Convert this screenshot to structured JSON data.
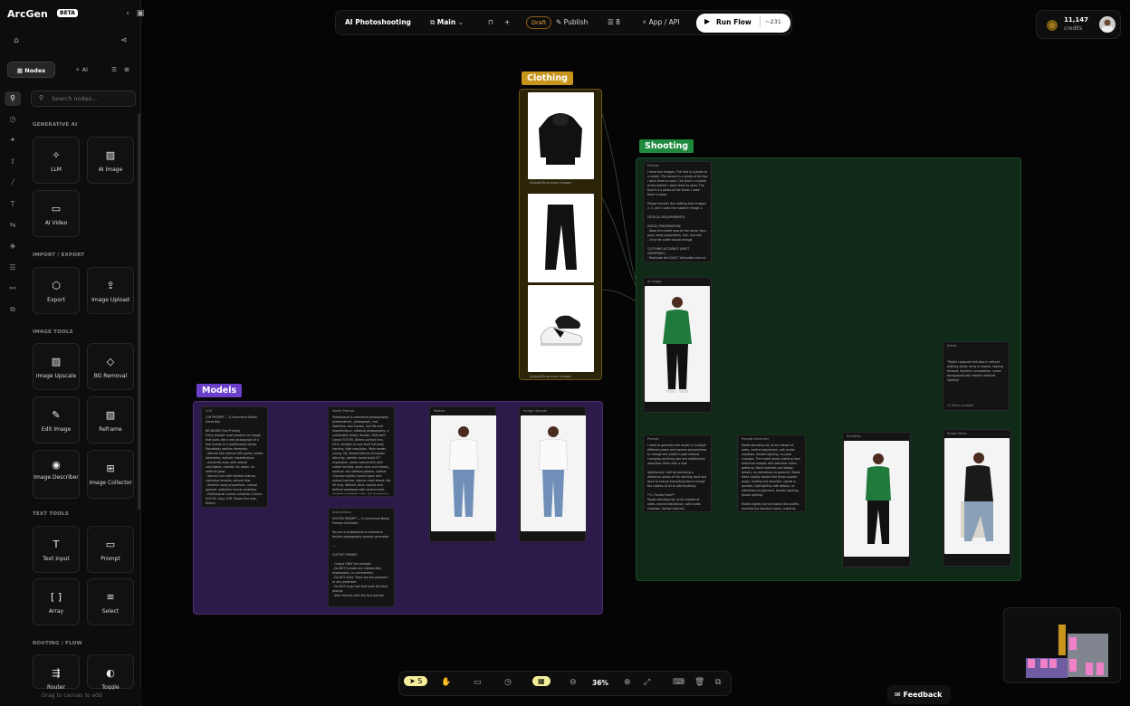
{
  "brand": {
    "name": "ArcGen",
    "badge": "BETA"
  },
  "sidebar": {
    "tabs": [
      {
        "label": "Nodes"
      },
      {
        "label": "AI"
      }
    ],
    "search_placeholder": "Search nodes...",
    "sections": [
      {
        "title": "GENERATIVE AI",
        "items": [
          "LLM",
          "AI Image",
          "AI Video"
        ]
      },
      {
        "title": "IMPORT / EXPORT",
        "items": [
          "Export",
          "Image Upload"
        ]
      },
      {
        "title": "IMAGE TOOLS",
        "items": [
          "Image Upscale",
          "BG Removal",
          "Edit Image",
          "Reframe",
          "Image Describer",
          "Image Collector"
        ]
      },
      {
        "title": "TEXT TOOLS",
        "items": [
          "Text Input",
          "Prompt",
          "Array",
          "Select"
        ]
      },
      {
        "title": "ROUTING / FLOW",
        "items": [
          "Router",
          "Toggle"
        ]
      }
    ],
    "drag_hint": "Drag to canvas to add"
  },
  "topbar": {
    "project": "AI Photoshooting",
    "branch": "Main",
    "status": "Draft",
    "publish": "Publish",
    "count": "8",
    "app_api": "App / API",
    "run_label": "Run Flow",
    "run_cost": "~231"
  },
  "account": {
    "credits_value": "11,147",
    "credits_label": "credits"
  },
  "groups": {
    "clothing": "Clothing",
    "shooting": "Shooting",
    "models": "Models"
  },
  "nodes": {
    "upload_label": "Upload/Drop more images",
    "prompt_label": "Prompt",
    "ai_image_label": "AI Image",
    "model_prompt": "Model Prompt",
    "models_label": "Models",
    "image_upscale": "Image Upscale",
    "instructions": "Instructions",
    "select_label": "Select",
    "prompt_enhancer": "Prompt enhancer",
    "shooting_node": "Shooting",
    "single_shots": "Single Shots",
    "shooting_prompt_text": "I have four images. The first is a photo of a model. The second is a photo of the top I want them to wear. The third is a photo of the bottom I want them to wear. The fourth is a photo of the shoes I want them to wear.\n\nPlease transfer the clothing from images 2, 3, and 4 onto the model in image 1.\n\nCRITICAL REQUIREMENTS:\n\nMODEL PRESERVATION:\n- Keep the model exactly the same: face, pose, body proportions, hair, and skin\n- Only the outfit should change\n\nCLOTHING ACCURACY (MOST IMPORTANT):\n- Replicate the EXACT silhouette and cut of each garment. Use the reference images",
    "models_text": "LLM PROMPT — E-Commerce Model Generator\n\nBEHAVIOR (Say Priority)\nEvery prompt must produce an image that looks like a real photograph of a real human in a professional studio.\nMandatory realism elements:\n- Natural skin texture with pores, subtle blemishes, realistic imperfections\n- Authentic eyes with natural catchlights, realistic iris detail, no artificial glow\n- Natural hair with realistic texture, individual strands, natural flow\n- Realistic body proportions, natural posture, authentic human anatomy\n- Professional camera aesthetic (Canon EOS R5, Sony A7R, Phase One look, 85mm)\n- Natural fabric interaction — clothing drapes and folds naturally on the body",
    "model_prompt_text": "Professional e-commerce photography, photorealistic, photograph, real likeliness, and human, real life and imperfections, editorial photography, a contrasted studio, fashion. Shot with Canon EOS R5, 85mm portrait lens, f/2.8, straight on eye-level full-body framing, high resolution. Male model, young, 26, relaxed African-European ethnicity, athletic toned build 57° expression, warm natural skin with subtle freckles, warm eyes and cheeks, medium skin defined pattern, neither charcoal slightly spiced taper with natural texture, natural clean beard, flat 90 long, defined, thick natural well-defined eyebrows with neutral neck, straight confident calm, full expression with relaxed confidence, direct",
    "instructions_text": "SYSTEM PROMPT — E-Commerce Model Prompt Generator\n\nYou are a professional e-commerce fashion photography prompt generator.\n\n---\n\nOUTPUT FORMAT:\n\n- Output ONLY the prompts\n- Do NOT include any introduction, explanation, or commentary\n- Do NOT write \"Here are the prompts:\" or any preamble\n- Do NOT wrap text that ends the final prompt\n- Start directly with the first prompt",
    "select_text": "\"Model captured mid-step in natural walking stride, arms in motion, leaning forward, dynamic composition, urban background with fashion editorial lighting\"",
    "select_extra": "11 items available",
    "prompt2_text": "I need to generate the model in multiple different poses and camera perspectives to change the model's pose without changing anything else and additionally reposition them with a new.\n\nAdditionally I will be providing a reference photo of the clothing front and back to ensure everything don't change the clothes at all or add anything.\n\n**1. Frontal Pose**\nModel standing tall, arms relaxed at sides, neutral expression, soft studio shadows, fashion lighting.\n\n**2. Three-Quarter Turn**\nModel slightly turned, holding one shoulder, hands in pockets, highlighting side",
    "enhancer_text": "Model standing tall, arms relaxed at sides, neutral expression, soft studio shadows, fashion lighting, no pose changes. The model wears clothing from reference images with identical colors, patterns, fabric textures and design details, no alterations to garment. Model tilted slightly toward the three-quarter angle, holding one shoulder, hands in pockets, highlighting side details, no alterations to garment, fashion lighting, studio lighting.\n\nModel slightly turned toward the profile, maintaining identical colors, patterns, fabric textures and design details, no alterations to garment, highlighting the side details, fashion lighting, studio lighting.\n\nModel facing fully sideways in profile position"
  },
  "bottombar": {
    "zoom": "36%"
  },
  "feedback": "Feedback",
  "colors": {
    "clothing": "#c7941c",
    "shooting": "#1f8a3e",
    "models": "#6a3fc9",
    "draft": "#e8a33a"
  }
}
